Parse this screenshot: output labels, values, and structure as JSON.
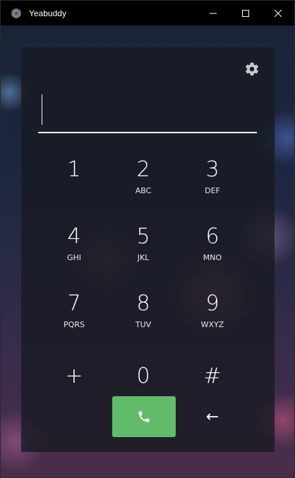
{
  "window": {
    "title": "Yeabuddy",
    "app_icon": "hexagon-logo-icon",
    "controls": [
      "minimize-icon",
      "maximize-icon",
      "close-icon"
    ]
  },
  "dialer": {
    "settings_icon": "gear-icon",
    "number_value": "",
    "keys": [
      {
        "digit": "1",
        "letters": ""
      },
      {
        "digit": "2",
        "letters": "ABC"
      },
      {
        "digit": "3",
        "letters": "DEF"
      },
      {
        "digit": "4",
        "letters": "GHI"
      },
      {
        "digit": "5",
        "letters": "JKL"
      },
      {
        "digit": "6",
        "letters": "MNO"
      },
      {
        "digit": "7",
        "letters": "PQRS"
      },
      {
        "digit": "8",
        "letters": "TUV"
      },
      {
        "digit": "9",
        "letters": "WXYZ"
      },
      {
        "digit": "+",
        "letters": ""
      },
      {
        "digit": "0",
        "letters": ""
      },
      {
        "digit": "#",
        "letters": ""
      }
    ],
    "call_icon": "phone-icon",
    "backspace_glyph": "←",
    "colors": {
      "call": "#62bb6a",
      "panel": "#181a22"
    }
  }
}
